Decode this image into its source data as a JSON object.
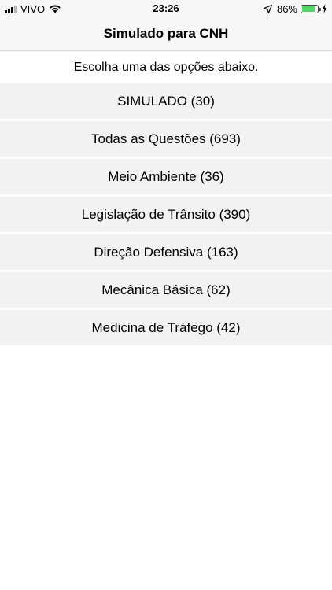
{
  "status_bar": {
    "carrier": "VIVO",
    "time": "23:26",
    "battery_percent": "86%",
    "battery_level": 0.86,
    "battery_color": "#4cd964",
    "icons": [
      "signal-icon",
      "wifi-icon",
      "location-icon",
      "battery-icon",
      "charging-icon"
    ]
  },
  "nav": {
    "title": "Simulado para CNH"
  },
  "subtitle": "Escolha uma das opções abaixo.",
  "menu": {
    "items": [
      {
        "label": "SIMULADO (30)"
      },
      {
        "label": "Todas as Questões (693)"
      },
      {
        "label": "Meio Ambiente (36)"
      },
      {
        "label": "Legislação de Trânsito (390)"
      },
      {
        "label": "Direção Defensiva (163)"
      },
      {
        "label": "Mecânica Básica (62)"
      },
      {
        "label": "Medicina de Tráfego (42)"
      }
    ]
  },
  "colors": {
    "row_background": "#f2f2f2",
    "bar_background": "#f7f7f7"
  }
}
